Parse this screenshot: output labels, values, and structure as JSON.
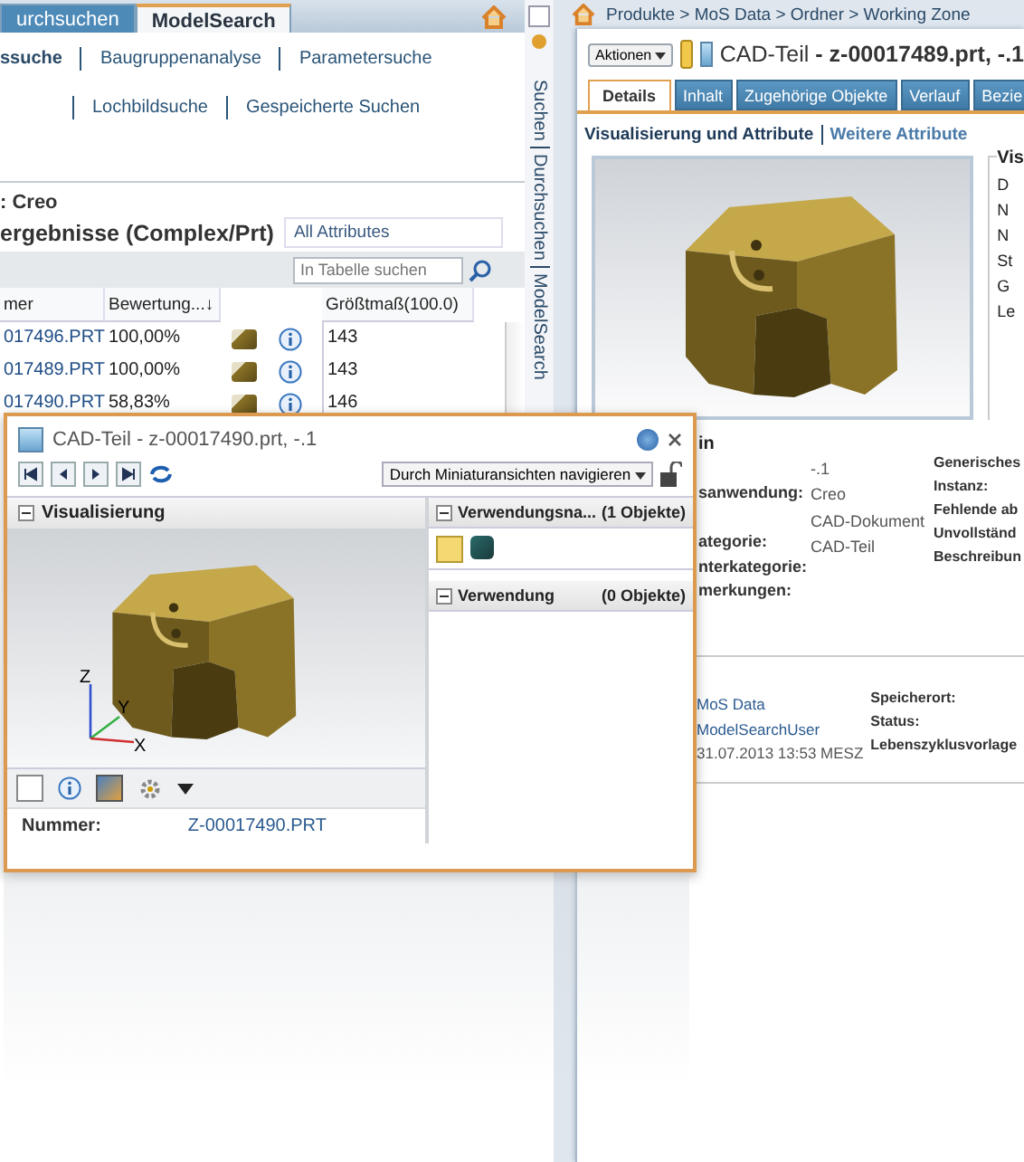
{
  "search_window": {
    "tabs": [
      {
        "label": "urchsuchen",
        "selected": false
      },
      {
        "label": "ModelSearch",
        "selected": true
      }
    ],
    "nav_rows": [
      [
        {
          "label": "ssuche",
          "selected": true
        },
        {
          "label": "Baugruppenanalyse",
          "selected": false
        },
        {
          "label": "Parametersuche",
          "selected": false
        }
      ],
      [
        {
          "label": "Lochbildsuche",
          "selected": false
        },
        {
          "label": "Gespeicherte Suchen",
          "selected": false
        }
      ]
    ],
    "source_label": ": Creo",
    "results_title": "ergebnisse (Complex/Prt)",
    "attribute_filter": "All Attributes",
    "table_search": {
      "placeholder": "In Tabelle suchen"
    },
    "table": {
      "columns": [
        "mer",
        "Bewertung...↓",
        "Größtmaß(100.0)"
      ],
      "rows": [
        {
          "name": "017496.PRT",
          "score": "100,00%",
          "size": "143"
        },
        {
          "name": "017489.PRT",
          "score": "100,00%",
          "size": "143"
        },
        {
          "name": "017490.PRT",
          "score": "58,83%",
          "size": "146"
        }
      ]
    }
  },
  "side_strip": {
    "items": [
      "Suchen",
      "Durchsuchen",
      "ModelSearch"
    ]
  },
  "detail_window": {
    "breadcrumb": "Produkte > MoS Data > Ordner > Working Zone",
    "actions_button": "Aktionen",
    "title": "CAD-Teil **- z-00017489.prt, -.1**",
    "tabs": [
      {
        "label": "Details",
        "selected": true
      },
      {
        "label": "Inhalt",
        "selected": false
      },
      {
        "label": "Zugehörige Objekte",
        "selected": false
      },
      {
        "label": "Verlauf",
        "selected": false
      },
      {
        "label": "Bezie",
        "selected": false
      }
    ],
    "sub_links": [
      {
        "label": "Visualisierung und Attribute",
        "selected": true
      },
      {
        "label": "Weitere Attribute",
        "selected": false
      }
    ],
    "info_panel": {
      "title": "Vis",
      "labels": [
        "D",
        "N",
        "N",
        "St",
        "G",
        "Le"
      ]
    },
    "attributes_section": {
      "heading": "in",
      "labels": [
        "sanwendung:",
        "ategorie:",
        "nterkategorie:",
        "merkungen:"
      ],
      "values": [
        "-.1",
        "Creo",
        "CAD-Dokument",
        "CAD-Teil"
      ],
      "right_labels": [
        "Generisches",
        "Instanz:",
        "Fehlende ab",
        "Unvollständ",
        "Beschreibun"
      ]
    },
    "system_section": {
      "values": [
        "MoS Data",
        "ModelSearchUser",
        "31.07.2013 13:53 MESZ"
      ],
      "labels": [
        "Speicherort:",
        "Status:",
        "Lebenszyklusvorlage"
      ]
    }
  },
  "viewer_window": {
    "title": "CAD-Teil - z-00017490.prt, -.1",
    "navigate_dropdown": "Durch Miniaturansichten navigieren",
    "visualization": {
      "title": "Visualisierung",
      "expanded": true
    },
    "axes": [
      "X",
      "Y",
      "Z"
    ],
    "panels": [
      {
        "title": "Verwendungsna...",
        "count": "(1 Objekte)",
        "expanded": true
      },
      {
        "title": "Verwendung",
        "count": "(0 Objekte)",
        "expanded": true
      }
    ],
    "field": {
      "label": "Nummer:",
      "value": "Z-00017490.PRT"
    }
  }
}
